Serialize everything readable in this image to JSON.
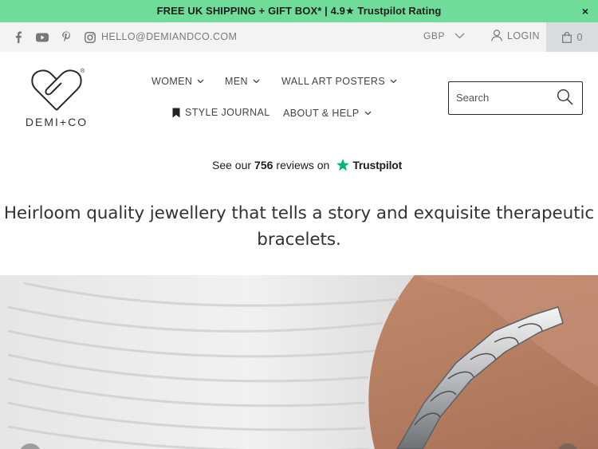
{
  "announcement": {
    "text": "FREE UK SHIPPING + GIFT BOX* | 4.9★ Trustpilot Rating",
    "close": "×"
  },
  "utility": {
    "social_icons": [
      "facebook-icon",
      "youtube-icon",
      "pinterest-icon",
      "instagram-icon"
    ],
    "email": "HELLO@DEMIANDCO.COM",
    "currency": "GBP",
    "login": "LOGIN",
    "cart_count": "0"
  },
  "brand": {
    "name": "DEMI+CO",
    "registered": "®"
  },
  "nav": {
    "women": "WOMEN",
    "men": "MEN",
    "wall_art": "WALL ART POSTERS",
    "style_journal": "STYLE JOURNAL",
    "about": "ABOUT & HELP"
  },
  "search": {
    "placeholder": "Search"
  },
  "trustpilot": {
    "prefix": "See our",
    "count": "756",
    "suffix": "reviews on",
    "brand": "Trustpilot"
  },
  "tagline": "Heirloom quality jewellery that tells a story and exquisite therapeutic bracelets.",
  "colors": {
    "announcement_bg": "#6fdc9a",
    "utility_bg": "#f3f3f4",
    "cart_bg": "#d8dbe0",
    "trustpilot_star": "#00b67a"
  }
}
